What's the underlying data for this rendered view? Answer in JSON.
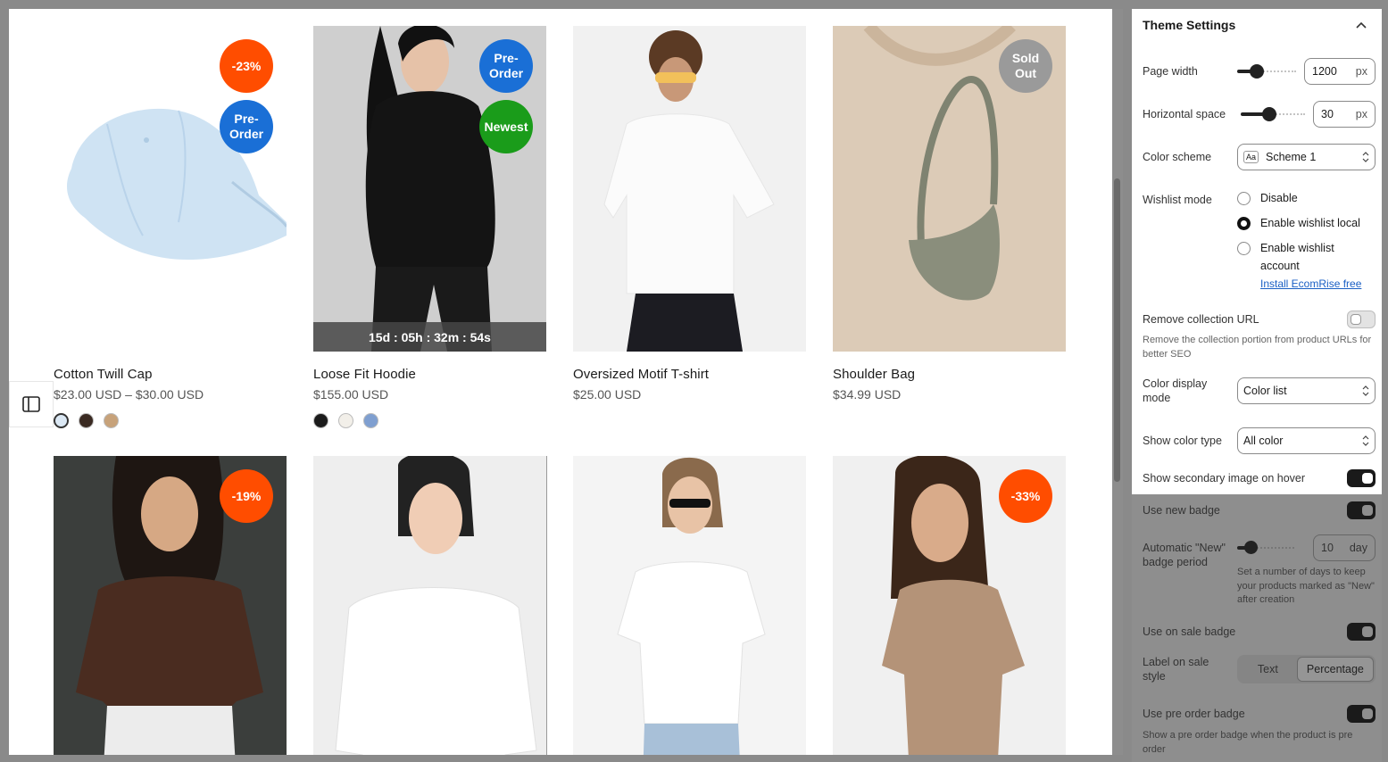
{
  "products": [
    {
      "name": "Cotton Twill Cap",
      "price": "$23.00 USD – $30.00 USD",
      "badges": [
        "-23%",
        "Pre-\nOrder"
      ],
      "swatches": [
        "#dbe8f4",
        "#3a2a22",
        "#c7a27a"
      ]
    },
    {
      "name": "Loose Fit Hoodie",
      "price": "$155.00 USD",
      "badges": [
        "Pre-\nOrder",
        "Newest"
      ],
      "countdown": "15d : 05h : 32m : 54s",
      "swatches": [
        "#1b1b1b",
        "#f2efe9",
        "#7f9fd0"
      ]
    },
    {
      "name": "Oversized Motif T-shirt",
      "price": "$25.00 USD",
      "badges": []
    },
    {
      "name": "Shoulder Bag",
      "price": "$34.99 USD",
      "badges": [
        "Sold\nOut"
      ]
    },
    {
      "badges": [
        "-19%"
      ]
    },
    {
      "badges": []
    },
    {
      "badges": []
    },
    {
      "badges": [
        "-33%"
      ]
    }
  ],
  "colors": {
    "sale_badge": "#ff4d00",
    "preorder_badge": "#1a6fd6",
    "new_badge": "#1a9c1a",
    "soldout_badge": "#9a9a9a"
  },
  "panel": {
    "title": "Theme Settings",
    "page_width_label": "Page width",
    "page_width_value": "1200",
    "page_width_unit": "px",
    "hspace_label": "Horizontal space",
    "hspace_value": "30",
    "hspace_unit": "px",
    "color_scheme_label": "Color scheme",
    "color_scheme_value": "Scheme 1",
    "color_scheme_icon": "Aa",
    "wishlist_label": "Wishlist mode",
    "wishlist_options": [
      "Disable",
      "Enable wishlist local",
      "Enable wishlist account"
    ],
    "wishlist_selected": "Enable wishlist local",
    "install_link": "Install EcomRise free",
    "remove_url_label": "Remove collection URL",
    "remove_url_help": "Remove the collection portion from product URLs for better SEO",
    "color_display_label": "Color display mode",
    "color_display_value": "Color list",
    "show_color_type_label": "Show color type",
    "show_color_type_value": "All color",
    "secondary_image_label": "Show secondary image on hover",
    "new_badge_label": "Use new badge",
    "new_badge_period_label": "Automatic \"New\" badge period",
    "new_badge_period_value": "10",
    "new_badge_period_unit": "day",
    "new_badge_period_help": "Set a number of days to keep your products marked as \"New\" after creation",
    "sale_badge_label": "Use on sale badge",
    "sale_style_label": "Label on sale style",
    "sale_style_options": [
      "Text",
      "Percentage"
    ],
    "sale_style_selected": "Percentage",
    "preorder_badge_label": "Use pre order badge",
    "preorder_badge_help": "Show a pre order badge when the product is pre order"
  }
}
